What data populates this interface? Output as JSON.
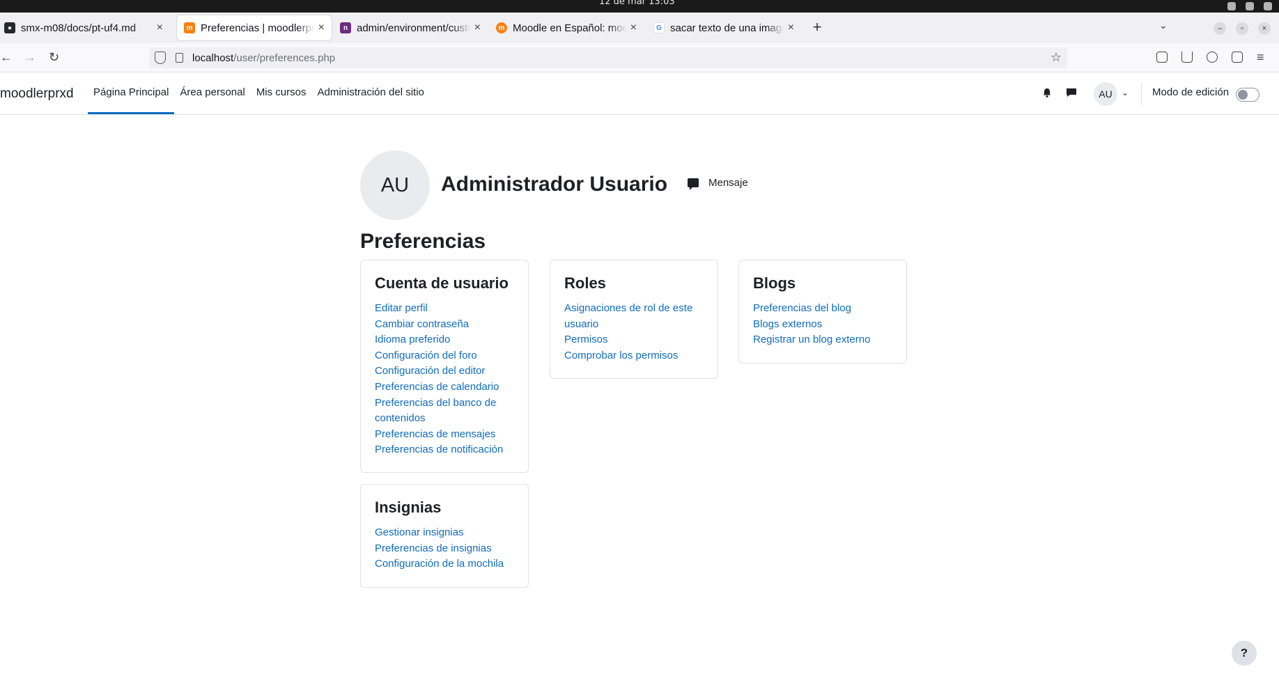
{
  "os": {
    "clock": "12 de mar  13:03"
  },
  "browser": {
    "tabs": [
      {
        "title": "smx-m08/docs/pt-uf4.md",
        "favicon": "github-icon",
        "color": "#24292f",
        "active": false
      },
      {
        "title": "Preferencias | moodlerprxd",
        "favicon": "moodle-icon",
        "color": "#f98012",
        "active": true
      },
      {
        "title": "admin/environment/custom",
        "favicon": "git-host-icon",
        "color": "#6b2d7e",
        "active": false
      },
      {
        "title": "Moodle en Español: moodle",
        "favicon": "moodle-circle-icon",
        "color": "#f98012",
        "active": false
      },
      {
        "title": "sacar texto de una imagen",
        "favicon": "google-icon",
        "color": "#4285f4",
        "active": false
      }
    ],
    "url": {
      "host": "localhost",
      "path": "/user/preferences.php"
    }
  },
  "header": {
    "brand": "moodlerprxd",
    "nav": [
      "Página Principal",
      "Área personal",
      "Mis cursos",
      "Administración del sitio"
    ],
    "user_initials": "AU",
    "edit_mode_label": "Modo de edición",
    "edit_mode_on": false
  },
  "profile": {
    "initials": "AU",
    "name": "Administrador Usuario",
    "message_label": "Mensaje"
  },
  "page_title": "Preferencias",
  "cards": {
    "account": {
      "title": "Cuenta de usuario",
      "links": [
        "Editar perfil",
        "Cambiar contraseña",
        "Idioma preferido",
        "Configuración del foro",
        "Configuración del editor",
        "Preferencias de calendario",
        "Preferencias del banco de contenidos",
        "Preferencias de mensajes",
        "Preferencias de notificación"
      ]
    },
    "roles": {
      "title": "Roles",
      "links": [
        "Asignaciones de rol de este usuario",
        "Permisos",
        "Comprobar los permisos"
      ]
    },
    "blogs": {
      "title": "Blogs",
      "links": [
        "Preferencias del blog",
        "Blogs externos",
        "Registrar un blog externo"
      ]
    },
    "badges": {
      "title": "Insignias",
      "links": [
        "Gestionar insignias",
        "Preferencias de insignias",
        "Configuración de la mochila"
      ]
    }
  },
  "help_label": "?"
}
